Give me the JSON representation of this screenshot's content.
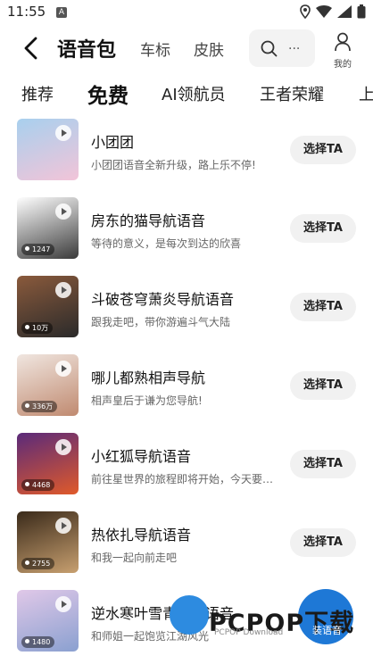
{
  "status_bar": {
    "time": "11:55",
    "notification_letter": "A"
  },
  "header": {
    "title": "语音包",
    "tabs": [
      "车标",
      "皮肤"
    ],
    "search_placeholder": "...",
    "mine_label": "我的"
  },
  "category_tabs": [
    {
      "label": "推荐",
      "active": false
    },
    {
      "label": "免费",
      "active": true
    },
    {
      "label": "AI领航员",
      "active": false
    },
    {
      "label": "王者荣耀",
      "active": false
    },
    {
      "label": "上",
      "active": false
    }
  ],
  "voice_packs": [
    {
      "title": "小团团",
      "subtitle": "小团团语音全新升级，路上乐不停!",
      "count": "",
      "button": "选择TA",
      "thumb_colors": [
        "#a8d0ee",
        "#f2c4d8"
      ]
    },
    {
      "title": "房东的猫导航语音",
      "subtitle": "等待的意义，是每次到达的欣喜",
      "count": "1247",
      "button": "选择TA",
      "thumb_colors": [
        "#ffffff",
        "#3a3a3a"
      ]
    },
    {
      "title": "斗破苍穹萧炎导航语音",
      "subtitle": "跟我走吧，带你游遍斗气大陆",
      "count": "10万",
      "button": "选择TA",
      "thumb_colors": [
        "#8a5a3c",
        "#2a2a2a"
      ]
    },
    {
      "title": "哪儿都熟相声导航",
      "subtitle": "相声皇后于谦为您导航!",
      "count": "336万",
      "button": "选择TA",
      "thumb_colors": [
        "#f0e6e0",
        "#c08a70"
      ]
    },
    {
      "title": "小红狐导航语音",
      "subtitle": "前往星世界的旅程即将开始，今天要去哪里呢？",
      "count": "4468",
      "button": "选择TA",
      "thumb_colors": [
        "#5a2a7a",
        "#e05a2a"
      ]
    },
    {
      "title": "热依扎导航语音",
      "subtitle": "和我一起向前走吧",
      "count": "2755",
      "button": "选择TA",
      "thumb_colors": [
        "#3a2a1a",
        "#c8a070"
      ]
    },
    {
      "title": "逆水寒叶雪青导航语音",
      "subtitle": "和师姐一起饱览江湖风光",
      "count": "1480",
      "button": "",
      "thumb_colors": [
        "#e0c8e8",
        "#8aa0d0"
      ]
    }
  ],
  "watermark": {
    "text": "PCPOP下载",
    "small": "PCPOP Download",
    "badge": "装语音"
  }
}
